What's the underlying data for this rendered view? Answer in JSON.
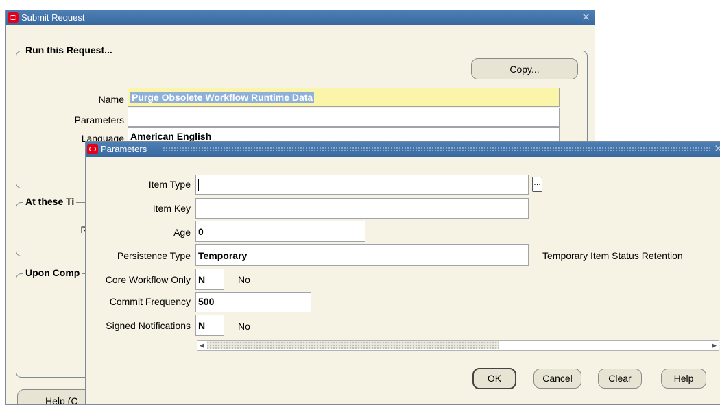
{
  "submit_window": {
    "title": "Submit Request",
    "run_group_title": "Run this Request...",
    "copy_button": "Copy...",
    "name_label": "Name",
    "name_value": "Purge Obsolete Workflow Runtime Data",
    "parameters_label": "Parameters",
    "parameters_value": "",
    "language_label": "Language",
    "language_value": "American English",
    "times_group_title": "At these Ti",
    "run_label": "Run",
    "completion_group_title": "Upon Comp",
    "help_button": "Help (C"
  },
  "parameters_window": {
    "title": "Parameters",
    "fields": {
      "item_type": {
        "label": "Item Type",
        "value": ""
      },
      "item_key": {
        "label": "Item Key",
        "value": ""
      },
      "age": {
        "label": "Age",
        "value": "0"
      },
      "persistence_type": {
        "label": "Persistence Type",
        "value": "Temporary",
        "description": "Temporary Item Status Retention"
      },
      "core_workflow_only": {
        "label": "Core Workflow Only",
        "value": "N",
        "description": "No"
      },
      "commit_frequency": {
        "label": "Commit Frequency",
        "value": "500"
      },
      "signed_notifications": {
        "label": "Signed Notifications",
        "value": "N",
        "description": "No"
      }
    },
    "buttons": {
      "ok": "OK",
      "cancel": "Cancel",
      "clear": "Clear",
      "help": "Help"
    }
  }
}
